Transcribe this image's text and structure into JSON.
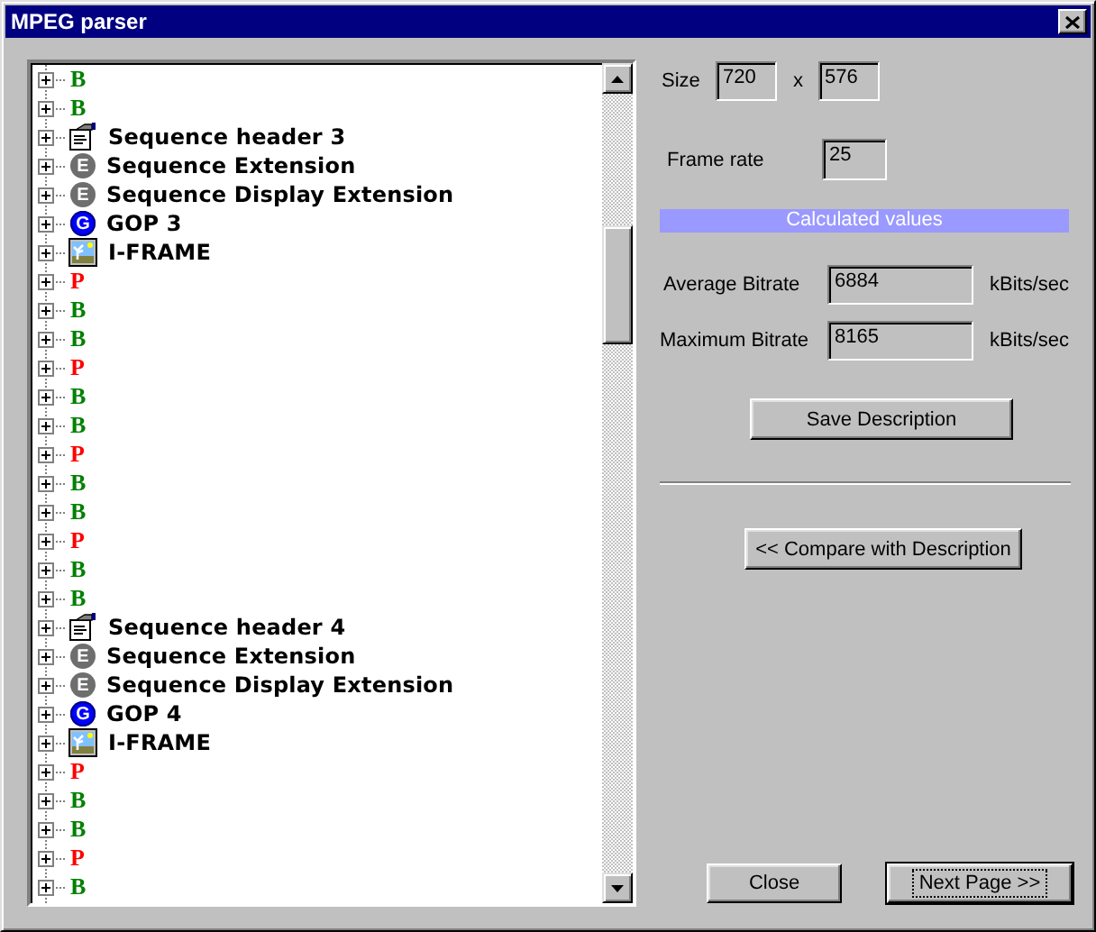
{
  "window": {
    "title": "MPEG parser"
  },
  "tree": {
    "items": [
      {
        "kind": "bframe",
        "label": "B",
        "expanded": false
      },
      {
        "kind": "bframe",
        "label": "B",
        "expanded": false
      },
      {
        "kind": "seqheader",
        "label": "Sequence header 3",
        "expanded": false
      },
      {
        "kind": "extension",
        "icon_letter": "E",
        "label": "Sequence Extension",
        "expanded": false
      },
      {
        "kind": "extension",
        "icon_letter": "E",
        "label": "Sequence Display Extension",
        "expanded": false
      },
      {
        "kind": "gop",
        "icon_letter": "G",
        "label": "GOP 3",
        "expanded": false
      },
      {
        "kind": "iframe",
        "label": "I-FRAME",
        "expanded": false
      },
      {
        "kind": "pframe",
        "label": "P",
        "expanded": false
      },
      {
        "kind": "bframe",
        "label": "B",
        "expanded": false
      },
      {
        "kind": "bframe",
        "label": "B",
        "expanded": false
      },
      {
        "kind": "pframe",
        "label": "P",
        "expanded": false
      },
      {
        "kind": "bframe",
        "label": "B",
        "expanded": false
      },
      {
        "kind": "bframe",
        "label": "B",
        "expanded": false
      },
      {
        "kind": "pframe",
        "label": "P",
        "expanded": false
      },
      {
        "kind": "bframe",
        "label": "B",
        "expanded": false
      },
      {
        "kind": "bframe",
        "label": "B",
        "expanded": false
      },
      {
        "kind": "pframe",
        "label": "P",
        "expanded": false
      },
      {
        "kind": "bframe",
        "label": "B",
        "expanded": false
      },
      {
        "kind": "bframe",
        "label": "B",
        "expanded": false
      },
      {
        "kind": "seqheader",
        "label": "Sequence header 4",
        "expanded": false
      },
      {
        "kind": "extension",
        "icon_letter": "E",
        "label": "Sequence Extension",
        "expanded": false
      },
      {
        "kind": "extension",
        "icon_letter": "E",
        "label": "Sequence Display Extension",
        "expanded": false
      },
      {
        "kind": "gop",
        "icon_letter": "G",
        "label": "GOP 4",
        "expanded": false
      },
      {
        "kind": "iframe",
        "label": "I-FRAME",
        "expanded": false
      },
      {
        "kind": "pframe",
        "label": "P",
        "expanded": false
      },
      {
        "kind": "bframe",
        "label": "B",
        "expanded": false
      },
      {
        "kind": "bframe",
        "label": "B",
        "expanded": false
      },
      {
        "kind": "pframe",
        "label": "P",
        "expanded": false
      },
      {
        "kind": "bframe",
        "label": "B",
        "expanded": false
      }
    ]
  },
  "size": {
    "label": "Size",
    "values": [
      "720",
      "576"
    ],
    "separator": "x"
  },
  "frame_rate": {
    "label": "Frame rate",
    "value": "25"
  },
  "calculated_header": "Calculated values",
  "average_bitrate": {
    "label": "Average Bitrate",
    "value": "6884",
    "unit": "kBits/sec"
  },
  "maximum_bitrate": {
    "label": "Maximum Bitrate",
    "value": "8165",
    "unit": "kBits/sec"
  },
  "save_button": {
    "label": "Save Description",
    "default": false
  },
  "compare_button": {
    "label": "<< Compare with Description",
    "default": false
  },
  "buttons": [
    {
      "label": "Close",
      "default": false
    },
    {
      "label": "Next Page >>",
      "default": true
    }
  ]
}
